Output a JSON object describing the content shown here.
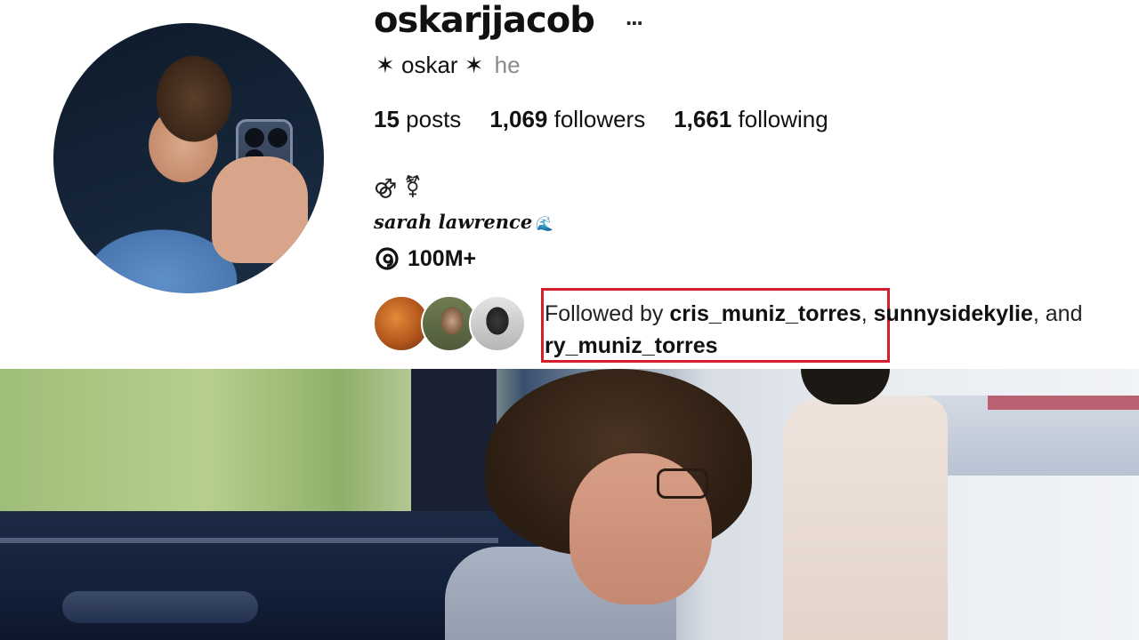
{
  "profile": {
    "username": "oskarjjacob",
    "more_icon": "...",
    "full_name": "✶ oskar ✶",
    "pronouns": "he",
    "stats": {
      "posts_count": "15",
      "posts_label": "posts",
      "followers_count": "1,069",
      "followers_label": "followers",
      "following_count": "1,661",
      "following_label": "following"
    },
    "bio_symbols": "⚣ ⚧",
    "bio_school": "sarah lawrence",
    "bio_school_emoji": "🌊",
    "threads_count": "100M+",
    "followed_by": {
      "prefix": "Followed by ",
      "user1": "cris_muniz_torres",
      "sep1": ", ",
      "user2": "sunnysidekylie",
      "sep2": ", and ",
      "user3": "ry_muniz_torres"
    }
  },
  "colors": {
    "highlight_box": "#d21f2b",
    "text_primary": "#111111",
    "text_secondary": "#8a8a8a"
  },
  "icons": {
    "more": "more-horizontal-icon",
    "threads": "threads-icon"
  }
}
